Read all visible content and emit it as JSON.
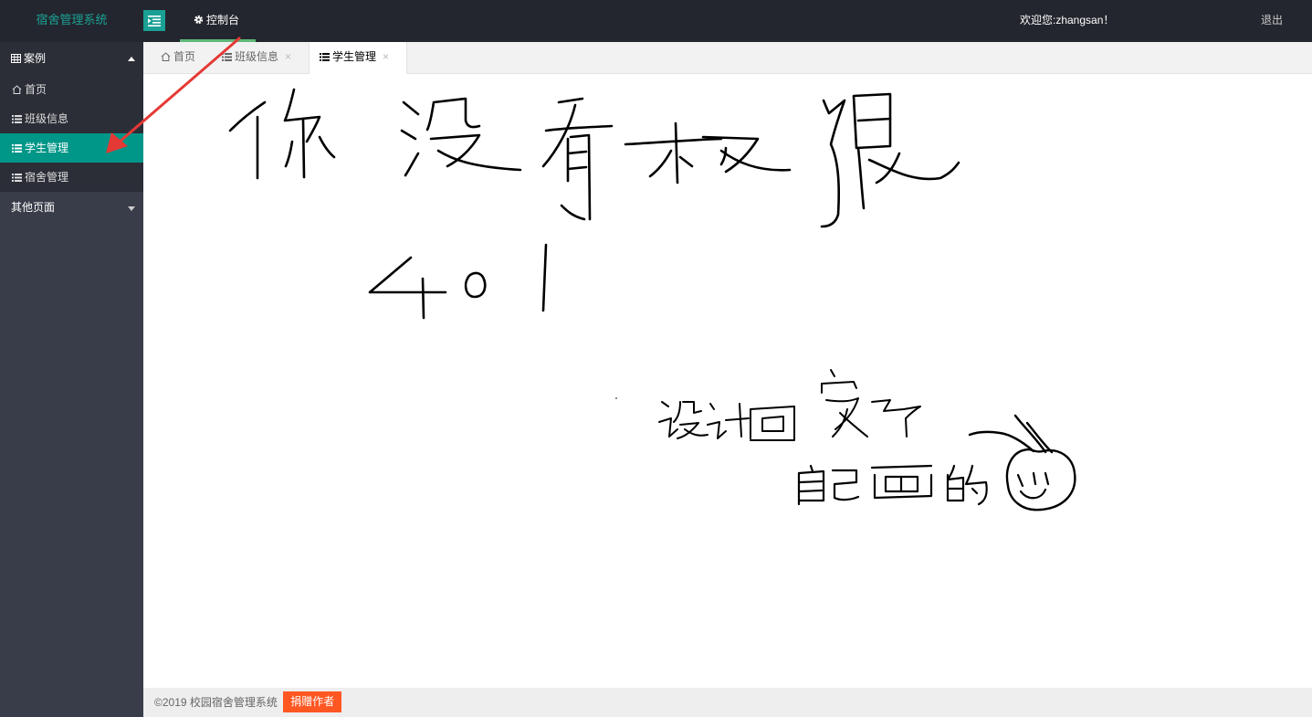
{
  "header": {
    "logo": "宿舍管理系统",
    "console_label": "控制台",
    "welcome": "欢迎您:zhangsan！",
    "logout": "退出"
  },
  "sidebar": {
    "group_label": "案例",
    "items": [
      {
        "label": "首页",
        "icon": "home-icon"
      },
      {
        "label": "班级信息",
        "icon": "list-icon"
      },
      {
        "label": "学生管理",
        "icon": "list-icon",
        "active": true
      },
      {
        "label": "宿舍管理",
        "icon": "list-icon"
      }
    ],
    "other_group_label": "其他页面"
  },
  "tabs": [
    {
      "label": "首页",
      "icon": "home-icon"
    },
    {
      "label": "班级信息",
      "icon": "list-icon",
      "close": "×"
    },
    {
      "label": "学生管理",
      "icon": "list-icon",
      "close": "×",
      "active": true
    }
  ],
  "content": {
    "drawing_description_words": [
      "你没有权限",
      "401",
      "设计回家了",
      "自己画的"
    ]
  },
  "footer": {
    "copyright": "©2019 校园宿舍管理系统",
    "donate_label": "捐赠作者"
  },
  "colors": {
    "topbar": "#23262e",
    "sidebar": "#393d49",
    "accent": "#009688",
    "logo_text": "#1aa094",
    "donate": "#ff5722",
    "arrow": "#e53935"
  }
}
